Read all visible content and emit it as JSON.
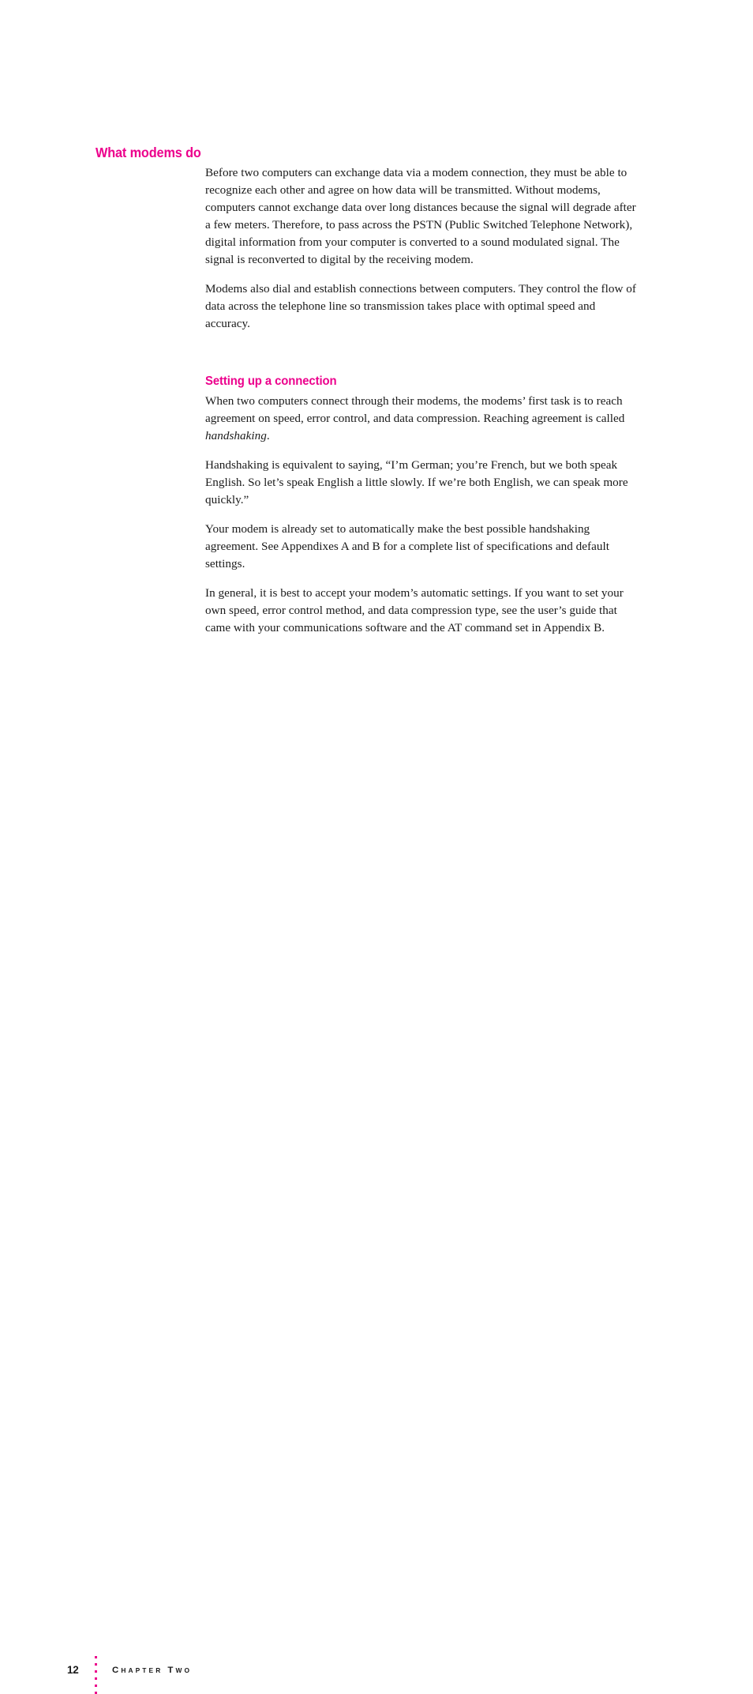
{
  "document": {
    "page_background": "#ffffff",
    "accent_color": "#ec008c",
    "text_color": "#1a1a1a"
  },
  "heading": {
    "title": "What modems do"
  },
  "section": {
    "subheading": "Setting up a connection"
  },
  "body": {
    "paragraphs_before_subheading": [
      "Before two computers can exchange data via a modem connection, they must be able to recognize each other and agree on how data will be transmitted. Without modems, computers cannot exchange data over long distances because the signal will degrade after a few meters. Therefore, to pass across the PSTN (Public Switched Telephone Network), digital information from your computer is converted to a sound modulated signal. The signal is reconverted to digital by the receiving modem.",
      "Modems also dial and establish connections between computers. They control the flow of data across the telephone line so transmission takes place with optimal speed and accuracy."
    ],
    "paragraph_handshaking": {
      "lead": "When two computers connect through their modems, the modems’ first task is to reach agreement on speed, error control, and data compression. Reaching agreement is called ",
      "italic_term": "handshaking",
      "tail": "."
    },
    "paragraphs_after_subheading": [
      "Handshaking is equivalent to saying, “I’m German; you’re French, but we both speak English. So let’s speak English a little slowly. If we’re both English, we can speak more quickly.”",
      "Your modem is already set to automatically make the best possible handshaking agreement. See Appendixes A and B for a complete list of specifications and default settings.",
      "In general, it is best to accept your modem’s automatic settings. If you want to set your own speed, error control method, and data compression type, see the user’s guide that came with your communications software and the AT command set in Appendix B."
    ]
  },
  "footer": {
    "page_number": "12",
    "chapter_label_parts": {
      "c": "C",
      "hapter": "HAPTER",
      "t": "T",
      "wo": "WO"
    },
    "chapter_label_plain": "CHAPTER TWO",
    "dot_count": 6
  }
}
